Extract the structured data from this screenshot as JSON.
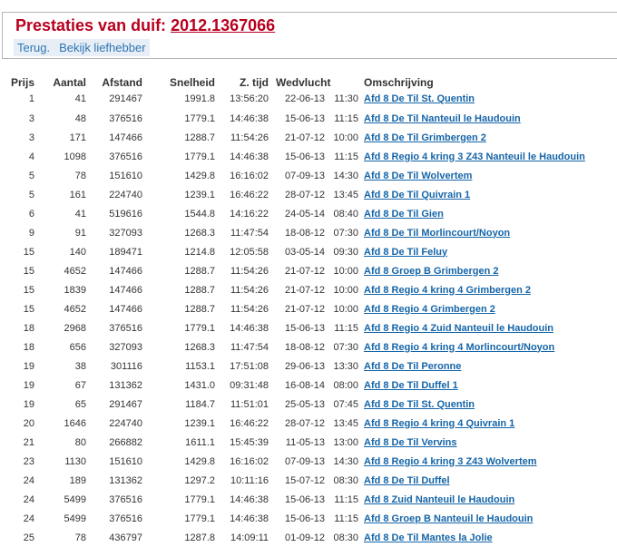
{
  "header": {
    "title_prefix": "Prestaties van duif: ",
    "ring_number": "2012.1367066",
    "actions": {
      "back": "Terug.",
      "view_owner": "Bekijk liefhebber"
    }
  },
  "table": {
    "columns": {
      "prijs": "Prijs",
      "aantal": "Aantal",
      "afstand": "Afstand",
      "snelheid": "Snelheid",
      "z_tijd": "Z. tijd",
      "wedvlucht": "Wedvlucht",
      "omschrijving": "Omschrijving"
    },
    "rows": [
      {
        "prijs": "1",
        "aantal": "41",
        "afstand": "291467",
        "snelheid": "1991.8",
        "z_tijd": "13:56:20",
        "datum": "22-06-13",
        "lostijd": "11:30",
        "omschrijving": "Afd 8 De Til St. Quentin"
      },
      {
        "prijs": "3",
        "aantal": "48",
        "afstand": "376516",
        "snelheid": "1779.1",
        "z_tijd": "14:46:38",
        "datum": "15-06-13",
        "lostijd": "11:15",
        "omschrijving": "Afd 8 De Til Nanteuil le Haudouin"
      },
      {
        "prijs": "3",
        "aantal": "171",
        "afstand": "147466",
        "snelheid": "1288.7",
        "z_tijd": "11:54:26",
        "datum": "21-07-12",
        "lostijd": "10:00",
        "omschrijving": "Afd 8 De Til Grimbergen 2"
      },
      {
        "prijs": "4",
        "aantal": "1098",
        "afstand": "376516",
        "snelheid": "1779.1",
        "z_tijd": "14:46:38",
        "datum": "15-06-13",
        "lostijd": "11:15",
        "omschrijving": "Afd 8 Regio 4 kring 3 Z43 Nanteuil le Haudouin"
      },
      {
        "prijs": "5",
        "aantal": "78",
        "afstand": "151610",
        "snelheid": "1429.8",
        "z_tijd": "16:16:02",
        "datum": "07-09-13",
        "lostijd": "14:30",
        "omschrijving": "Afd 8 De Til Wolvertem"
      },
      {
        "prijs": "5",
        "aantal": "161",
        "afstand": "224740",
        "snelheid": "1239.1",
        "z_tijd": "16:46:22",
        "datum": "28-07-12",
        "lostijd": "13:45",
        "omschrijving": "Afd 8 De Til Quivrain 1"
      },
      {
        "prijs": "6",
        "aantal": "41",
        "afstand": "519616",
        "snelheid": "1544.8",
        "z_tijd": "14:16:22",
        "datum": "24-05-14",
        "lostijd": "08:40",
        "omschrijving": "Afd 8 De Til Gien"
      },
      {
        "prijs": "9",
        "aantal": "91",
        "afstand": "327093",
        "snelheid": "1268.3",
        "z_tijd": "11:47:54",
        "datum": "18-08-12",
        "lostijd": "07:30",
        "omschrijving": "Afd 8 De Til Morlincourt/Noyon"
      },
      {
        "prijs": "15",
        "aantal": "140",
        "afstand": "189471",
        "snelheid": "1214.8",
        "z_tijd": "12:05:58",
        "datum": "03-05-14",
        "lostijd": "09:30",
        "omschrijving": "Afd 8 De Til Feluy"
      },
      {
        "prijs": "15",
        "aantal": "4652",
        "afstand": "147466",
        "snelheid": "1288.7",
        "z_tijd": "11:54:26",
        "datum": "21-07-12",
        "lostijd": "10:00",
        "omschrijving": "Afd 8 Groep B Grimbergen 2"
      },
      {
        "prijs": "15",
        "aantal": "1839",
        "afstand": "147466",
        "snelheid": "1288.7",
        "z_tijd": "11:54:26",
        "datum": "21-07-12",
        "lostijd": "10:00",
        "omschrijving": "Afd 8 Regio 4 kring 4 Grimbergen 2"
      },
      {
        "prijs": "15",
        "aantal": "4652",
        "afstand": "147466",
        "snelheid": "1288.7",
        "z_tijd": "11:54:26",
        "datum": "21-07-12",
        "lostijd": "10:00",
        "omschrijving": "Afd 8 Regio 4 Grimbergen 2"
      },
      {
        "prijs": "18",
        "aantal": "2968",
        "afstand": "376516",
        "snelheid": "1779.1",
        "z_tijd": "14:46:38",
        "datum": "15-06-13",
        "lostijd": "11:15",
        "omschrijving": "Afd 8 Regio 4 Zuid Nanteuil le Haudouin"
      },
      {
        "prijs": "18",
        "aantal": "656",
        "afstand": "327093",
        "snelheid": "1268.3",
        "z_tijd": "11:47:54",
        "datum": "18-08-12",
        "lostijd": "07:30",
        "omschrijving": "Afd 8 Regio 4 kring 4 Morlincourt/Noyon"
      },
      {
        "prijs": "19",
        "aantal": "38",
        "afstand": "301116",
        "snelheid": "1153.1",
        "z_tijd": "17:51:08",
        "datum": "29-06-13",
        "lostijd": "13:30",
        "omschrijving": "Afd 8 De Til Peronne"
      },
      {
        "prijs": "19",
        "aantal": "67",
        "afstand": "131362",
        "snelheid": "1431.0",
        "z_tijd": "09:31:48",
        "datum": "16-08-14",
        "lostijd": "08:00",
        "omschrijving": "Afd 8 De Til Duffel 1"
      },
      {
        "prijs": "19",
        "aantal": "65",
        "afstand": "291467",
        "snelheid": "1184.7",
        "z_tijd": "11:51:01",
        "datum": "25-05-13",
        "lostijd": "07:45",
        "omschrijving": "Afd 8 De Til St. Quentin"
      },
      {
        "prijs": "20",
        "aantal": "1646",
        "afstand": "224740",
        "snelheid": "1239.1",
        "z_tijd": "16:46:22",
        "datum": "28-07-12",
        "lostijd": "13:45",
        "omschrijving": "Afd 8 Regio 4 kring 4 Quivrain 1"
      },
      {
        "prijs": "21",
        "aantal": "80",
        "afstand": "266882",
        "snelheid": "1611.1",
        "z_tijd": "15:45:39",
        "datum": "11-05-13",
        "lostijd": "13:00",
        "omschrijving": "Afd 8 De Til Vervins"
      },
      {
        "prijs": "23",
        "aantal": "1130",
        "afstand": "151610",
        "snelheid": "1429.8",
        "z_tijd": "16:16:02",
        "datum": "07-09-13",
        "lostijd": "14:30",
        "omschrijving": "Afd 8 Regio 4 kring 3 Z43 Wolvertem"
      },
      {
        "prijs": "24",
        "aantal": "189",
        "afstand": "131362",
        "snelheid": "1297.2",
        "z_tijd": "10:11:16",
        "datum": "15-07-12",
        "lostijd": "08:30",
        "omschrijving": "Afd 8 De Til Duffel"
      },
      {
        "prijs": "24",
        "aantal": "5499",
        "afstand": "376516",
        "snelheid": "1779.1",
        "z_tijd": "14:46:38",
        "datum": "15-06-13",
        "lostijd": "11:15",
        "omschrijving": "Afd 8 Zuid Nanteuil le Haudouin"
      },
      {
        "prijs": "24",
        "aantal": "5499",
        "afstand": "376516",
        "snelheid": "1779.1",
        "z_tijd": "14:46:38",
        "datum": "15-06-13",
        "lostijd": "11:15",
        "omschrijving": "Afd 8 Groep B Nanteuil le Haudouin"
      },
      {
        "prijs": "25",
        "aantal": "78",
        "afstand": "436797",
        "snelheid": "1287.8",
        "z_tijd": "14:09:11",
        "datum": "01-09-12",
        "lostijd": "08:30",
        "omschrijving": "Afd 8 De Til Mantes la Jolie"
      }
    ]
  },
  "colors": {
    "title": "#b8001f",
    "link": "#1565a8",
    "action_link": "#2e75b6",
    "action_bg": "#e8eef5",
    "border": "#b5b5b5",
    "text": "#333333"
  }
}
